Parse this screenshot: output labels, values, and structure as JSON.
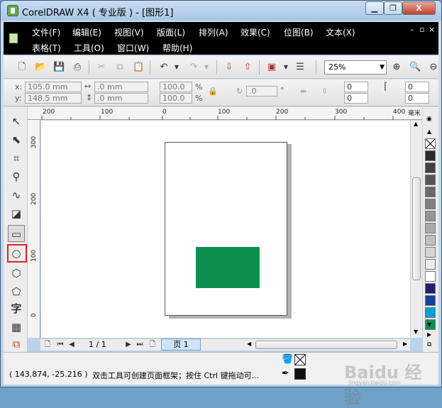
{
  "window": {
    "title": "CorelDRAW X4 ( 专业版 ) - [图形1]",
    "min_label": "▁",
    "max_label": "❐",
    "close_label": "X"
  },
  "menu": {
    "row1": [
      "文件(F)",
      "编辑(E)",
      "视图(V)",
      "版面(L)",
      "排列(A)",
      "效果(C)",
      "位图(B)",
      "文本(X)"
    ],
    "row2": [
      "表格(T)",
      "工具(O)",
      "窗口(W)",
      "帮助(H)"
    ],
    "mdi": [
      "–",
      "▫",
      "×"
    ]
  },
  "toolbar": {
    "zoom": "25%"
  },
  "propbar": {
    "x_label": "x:",
    "x": "105.0 mm",
    "y_label": "y:",
    "y": "148.5 mm",
    "w": ".0 mm",
    "h": ".0 mm",
    "scale_x": "100.0",
    "scale_y": "100.0",
    "pct": "%",
    "rotation": ".0",
    "deg": "°",
    "corner1": "0",
    "corner2": "0",
    "corner3": "0",
    "corner4": "0"
  },
  "ruler": {
    "unit": "毫米",
    "h_ticks": [
      "200",
      "100",
      "0",
      "100",
      "200",
      "300",
      "400"
    ],
    "v_ticks": [
      "300",
      "200",
      "100",
      "0"
    ]
  },
  "pagenav": {
    "counter": "1 / 1",
    "tab": "页 1"
  },
  "palette": {
    "colors": [
      "#2b2b2b",
      "#404040",
      "#555555",
      "#6a6a6a",
      "#808080",
      "#959595",
      "#aaaaaa",
      "#c0c0c0",
      "#d5d5d5",
      "#eaeaea",
      "#ffffff",
      "#2a1a6e",
      "#1040a0",
      "#00a0e0",
      "#0e8f52"
    ]
  },
  "status": {
    "coords": "( 143.874, -25.216 )",
    "hint": "双击工具可创建页面框架；按住 Ctrl 键拖动可..."
  },
  "watermark": {
    "text": "Baidu 经验",
    "sub": "jingyan.baidu.com"
  }
}
